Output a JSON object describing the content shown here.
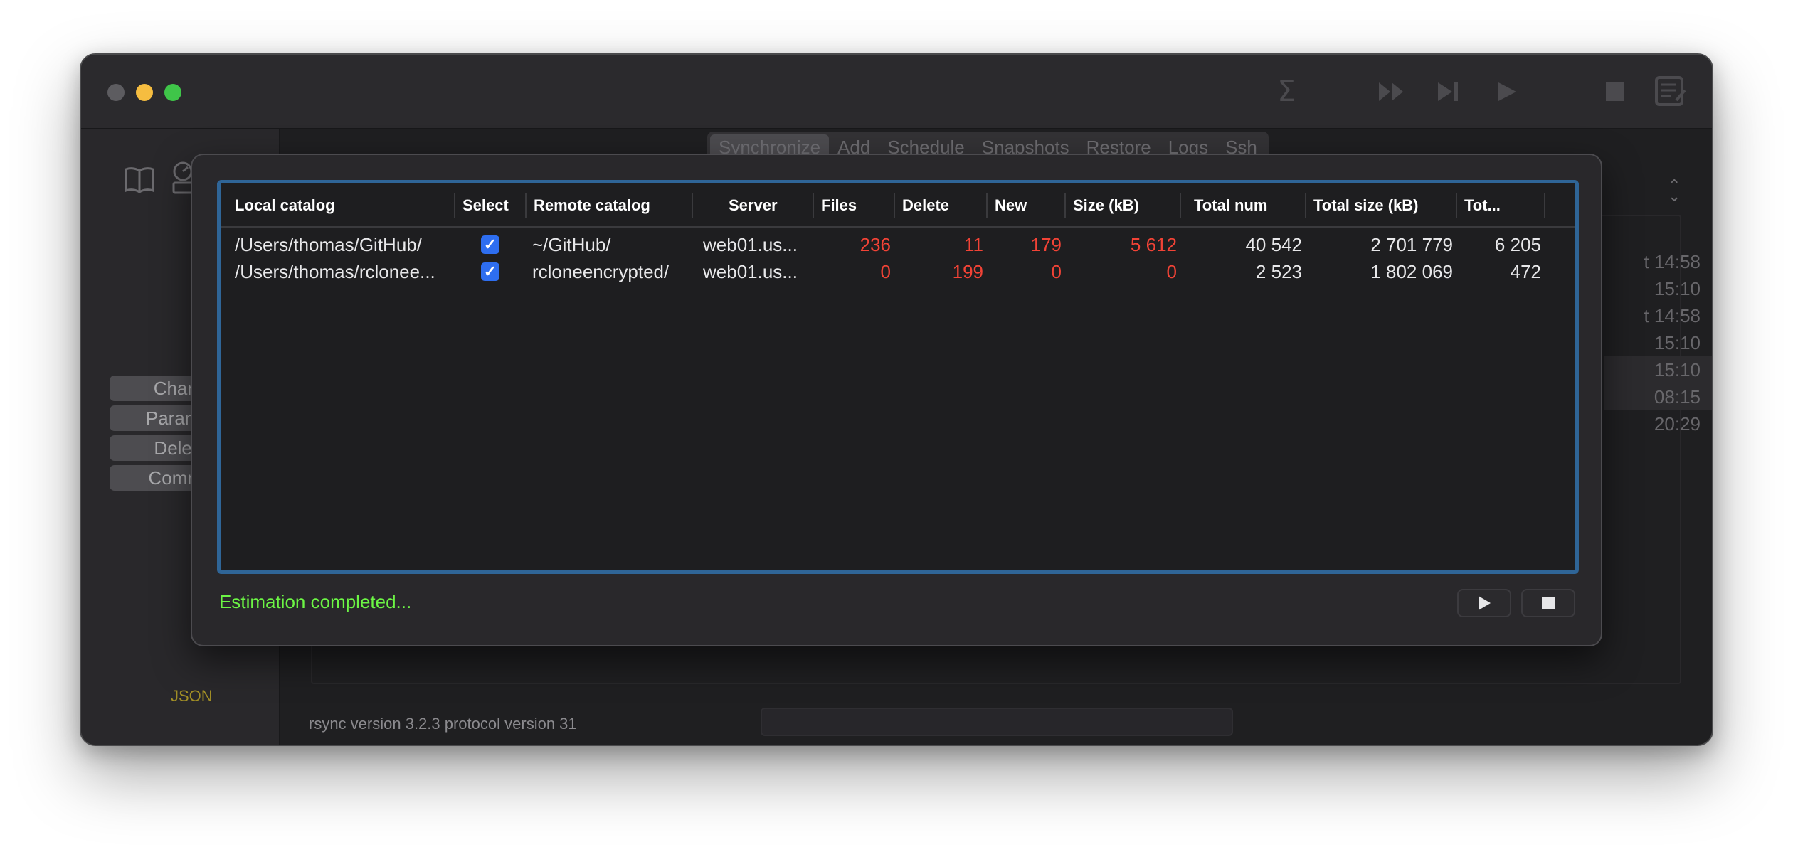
{
  "toolbar": {
    "icons": [
      "sigma-icon",
      "fast-forward-icon",
      "skip-forward-icon",
      "play-icon",
      "stop-icon",
      "document-edit-icon"
    ]
  },
  "sidebar": {
    "buttons": [
      "Chang",
      "Paramet",
      "Delete",
      "Comma"
    ],
    "json_label": "JSON"
  },
  "tabs": [
    {
      "label": "Synchronize",
      "active": true
    },
    {
      "label": "Add"
    },
    {
      "label": "Schedule"
    },
    {
      "label": "Snapshots"
    },
    {
      "label": "Restore"
    },
    {
      "label": "Logs"
    },
    {
      "label": "Ssh"
    }
  ],
  "background_list": [
    "t 14:58",
    "15:10",
    "t 14:58",
    "15:10",
    "15:10",
    "08:15",
    "20:29"
  ],
  "footer": {
    "rsync_version": "rsync  version 3.2.3  protocol version 31"
  },
  "estimation": {
    "columns": [
      "Local catalog",
      "Select",
      "Remote catalog",
      "Server",
      "Files",
      "Delete",
      "New",
      "Size (kB)",
      "Total num",
      "Total size (kB)",
      "Tot..."
    ],
    "rows": [
      {
        "local_catalog": "/Users/thomas/GitHub/",
        "selected": true,
        "remote_catalog": "~/GitHub/",
        "server": "web01.us...",
        "files": "236",
        "delete": "11",
        "new": "179",
        "size": "5 612",
        "total_num": "40 542",
        "total_size": "2 701 779",
        "tot": "6 205"
      },
      {
        "local_catalog": "/Users/thomas/rclonee...",
        "selected": true,
        "remote_catalog": "rcloneencrypted/",
        "server": "web01.us...",
        "files": "0",
        "delete": "199",
        "new": "0",
        "size": "0",
        "total_num": "2 523",
        "total_size": "1 802 069",
        "tot": "472"
      }
    ],
    "status": "Estimation completed...",
    "colors": {
      "status": "#6cf545",
      "changed_values": "#f24336",
      "checkbox": "#2e6ef0",
      "table_border": "#2f6597"
    }
  }
}
